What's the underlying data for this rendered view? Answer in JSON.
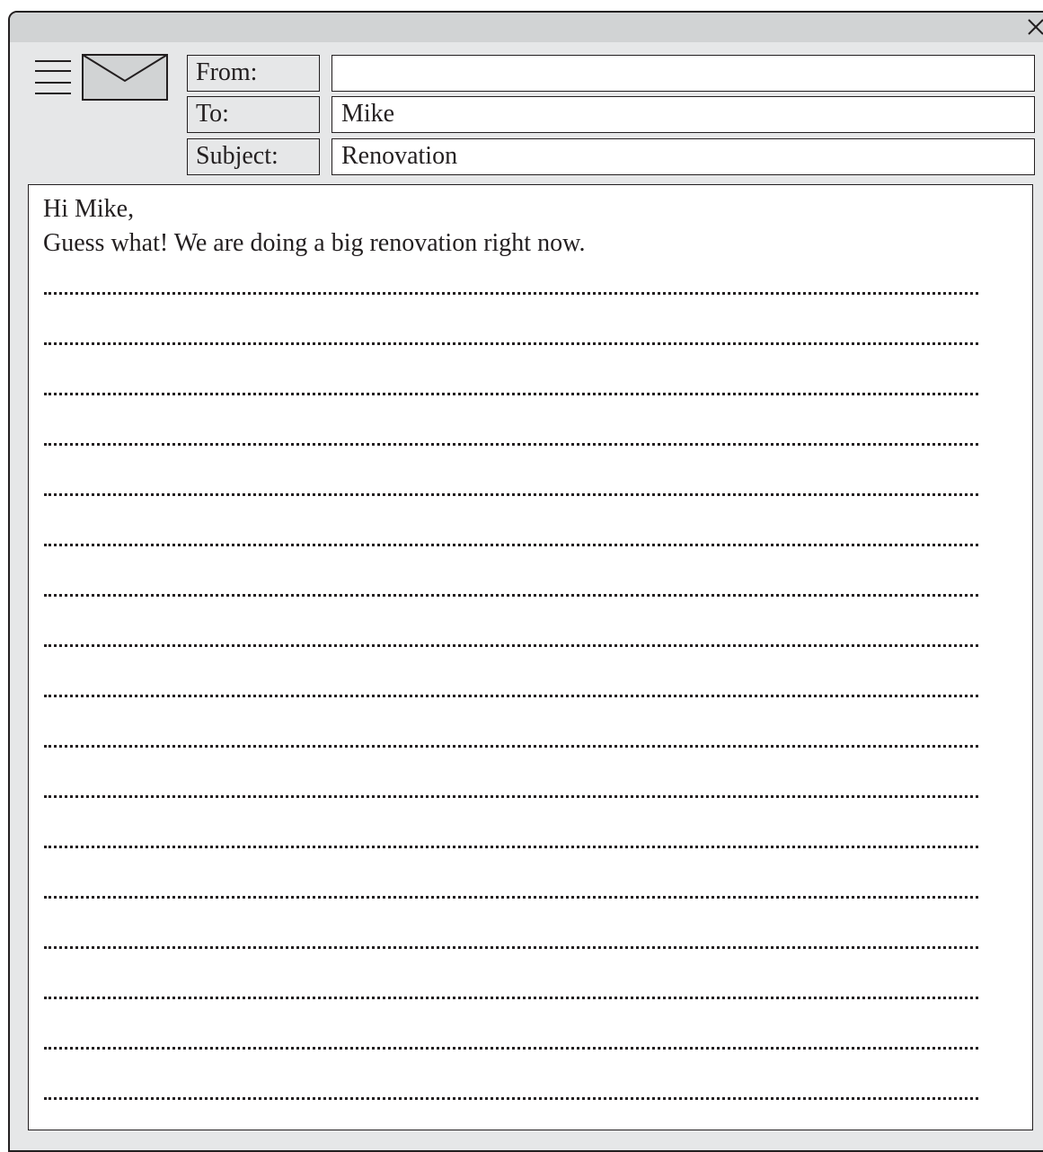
{
  "window": {
    "close_icon": "close-icon",
    "menu_icon": "menu-icon",
    "mail_icon": "envelope-icon"
  },
  "header": {
    "from_label": "From:",
    "from_value": "",
    "to_label": "To:",
    "to_value": "Mike",
    "subject_label": "Subject:",
    "subject_value": "Renovation"
  },
  "body": {
    "greeting": "Hi Mike,",
    "intro": "Guess what! We are doing a big renovation right now.",
    "blank_line_count": 17
  },
  "colors": {
    "frame": "#e6e7e8",
    "titlebar": "#d1d3d4",
    "ink": "#231f20",
    "field_bg": "#ffffff"
  }
}
